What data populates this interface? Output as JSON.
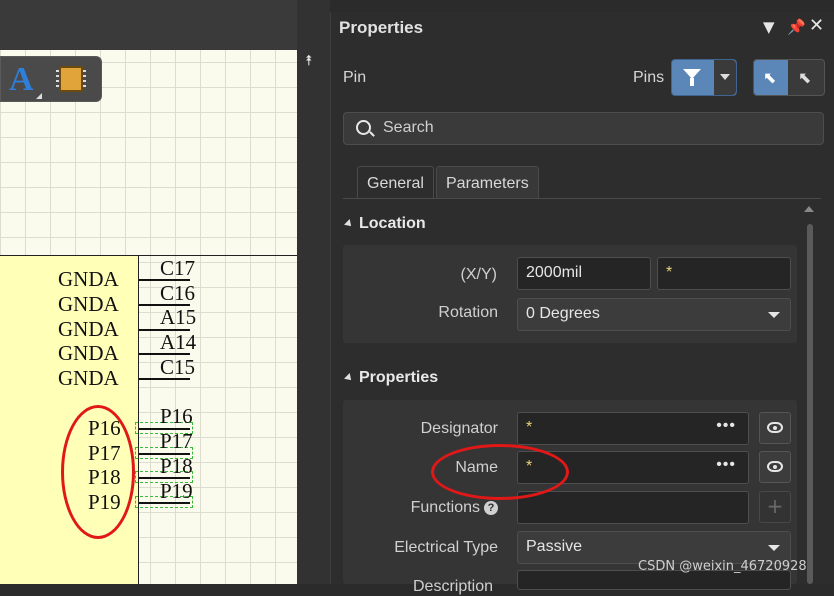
{
  "schematic": {
    "left_names": [
      "GNDA",
      "GNDA",
      "GNDA",
      "GNDA",
      "GNDA",
      "P16",
      "P17",
      "P18",
      "P19"
    ],
    "pin_numbers": [
      "C17",
      "C16",
      "A15",
      "A14",
      "C15",
      "P16",
      "P17",
      "P18",
      "P19"
    ]
  },
  "panel": {
    "title": "Properties",
    "object_kind": "Pin",
    "filter_label": "Pins",
    "search_placeholder": "Search",
    "tabs": [
      {
        "label": "General",
        "active": true
      },
      {
        "label": "Parameters",
        "active": false
      }
    ],
    "location": {
      "header": "Location",
      "xy_label": "(X/Y)",
      "x_value": "2000mil",
      "y_value": "*",
      "rotation_label": "Rotation",
      "rotation_value": "0 Degrees"
    },
    "properties": {
      "header": "Properties",
      "designator_label": "Designator",
      "designator_value": "*",
      "name_label": "Name",
      "name_value": "*",
      "functions_label": "Functions",
      "electrical_type_label": "Electrical Type",
      "electrical_type_value": "Passive",
      "description_label": "Description"
    }
  },
  "watermark": "CSDN @weixin_46720928",
  "colors": {
    "panel_bg": "#2d2d2d",
    "accent": "#5a86b8",
    "highlight_ellipse": "#e01818",
    "component_fill": "#ffffb8",
    "value_star": "#e8d27a"
  }
}
